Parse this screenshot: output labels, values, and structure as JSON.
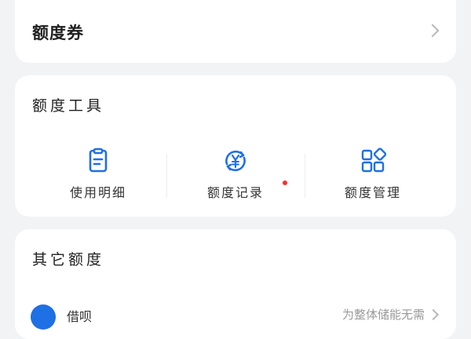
{
  "voucher": {
    "title": "额度券",
    "icon": "chevron-right-icon"
  },
  "tools": {
    "title": "额度工具",
    "accent": "#1f6fe5",
    "badge_color": "#ff2e2e",
    "items": [
      {
        "label": "使用明细",
        "icon": "document-list-icon"
      },
      {
        "label": "额度记录",
        "icon": "yen-refresh-icon",
        "badge": "red-dot"
      },
      {
        "label": "额度管理",
        "icon": "grid-manage-icon"
      }
    ]
  },
  "other": {
    "title": "其它额度",
    "row": {
      "label": "借呗",
      "hint": "为整体储能无需",
      "icon": "circle-logo-icon"
    }
  }
}
